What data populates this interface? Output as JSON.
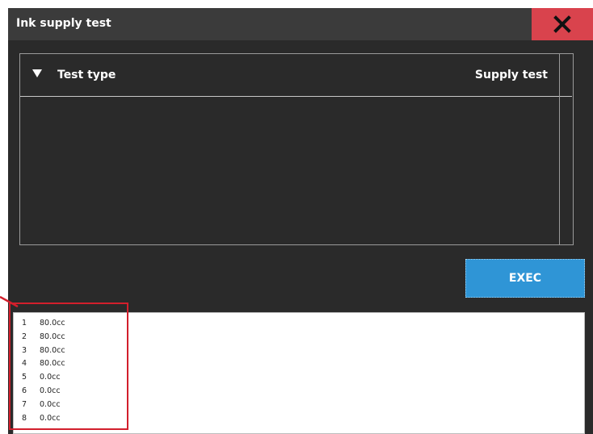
{
  "window": {
    "title": "Ink supply test",
    "close_icon": "close-x-icon"
  },
  "panel": {
    "header_label": "Test type",
    "header_value": "Supply test",
    "dropdown_icon": "triangle-down-icon"
  },
  "exec_button": {
    "label": "EXEC"
  },
  "log": {
    "rows": [
      {
        "index": "1",
        "value": "80.0cc"
      },
      {
        "index": "2",
        "value": "80.0cc"
      },
      {
        "index": "3",
        "value": "80.0cc"
      },
      {
        "index": "4",
        "value": "80.0cc"
      },
      {
        "index": "5",
        "value": "0.0cc"
      },
      {
        "index": "6",
        "value": "0.0cc"
      },
      {
        "index": "7",
        "value": "0.0cc"
      },
      {
        "index": "8",
        "value": "0.0cc"
      }
    ]
  },
  "colors": {
    "background": "#2a2a2a",
    "titlebar": "#3b3b3b",
    "close_button": "#d9434d",
    "exec_button": "#2f95d6",
    "highlight": "#d21f2c"
  }
}
